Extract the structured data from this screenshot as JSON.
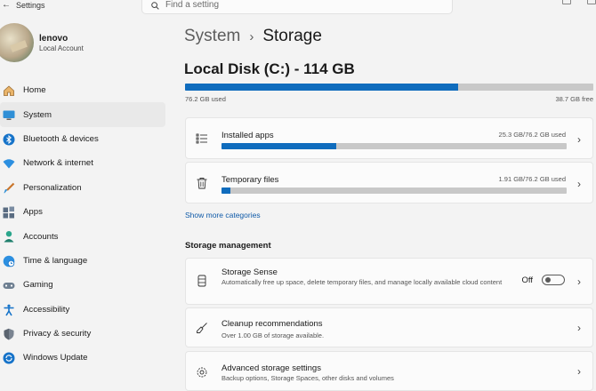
{
  "window": {
    "title": "Settings"
  },
  "search": {
    "placeholder": "Find a setting"
  },
  "profile": {
    "name": "lenovo",
    "account_type": "Local Account"
  },
  "nav": {
    "items": [
      {
        "label": "Home",
        "icon": "home-icon"
      },
      {
        "label": "System",
        "icon": "monitor-icon",
        "active": true
      },
      {
        "label": "Bluetooth & devices",
        "icon": "bluetooth-icon"
      },
      {
        "label": "Network & internet",
        "icon": "wifi-icon"
      },
      {
        "label": "Personalization",
        "icon": "brush-icon"
      },
      {
        "label": "Apps",
        "icon": "apps-icon"
      },
      {
        "label": "Accounts",
        "icon": "person-icon"
      },
      {
        "label": "Time & language",
        "icon": "globe-clock-icon"
      },
      {
        "label": "Gaming",
        "icon": "gamepad-icon"
      },
      {
        "label": "Accessibility",
        "icon": "accessibility-icon"
      },
      {
        "label": "Privacy & security",
        "icon": "shield-icon"
      },
      {
        "label": "Windows Update",
        "icon": "update-icon"
      }
    ]
  },
  "breadcrumb": {
    "parent": "System",
    "separator": "›",
    "current": "Storage"
  },
  "disk": {
    "title": "Local Disk (C:) - 114 GB",
    "used_label": "76.2 GB used",
    "free_label": "38.7 GB free",
    "used_fraction": 0.668
  },
  "categories": [
    {
      "title": "Installed apps",
      "usage": "25.3 GB/76.2 GB used",
      "fraction": 0.332,
      "icon": "list-icon"
    },
    {
      "title": "Temporary files",
      "usage": "1.91 GB/76.2 GB used",
      "fraction": 0.025,
      "icon": "trash-icon"
    }
  ],
  "show_more": "Show more categories",
  "storage_management": {
    "heading": "Storage management",
    "storage_sense": {
      "title": "Storage Sense",
      "description": "Automatically free up space, delete temporary files, and manage locally available cloud content",
      "toggle_label": "Off",
      "toggle_on": false
    },
    "cleanup": {
      "title": "Cleanup recommendations",
      "description": "Over 1.00 GB of storage available."
    },
    "advanced": {
      "title": "Advanced storage settings",
      "description": "Backup options, Storage Spaces, other disks and volumes"
    }
  },
  "colors": {
    "accent": "#0f6cbd",
    "bar_track": "#c8c8c8",
    "background": "#f3f3f3",
    "card": "#fbfbfb"
  }
}
